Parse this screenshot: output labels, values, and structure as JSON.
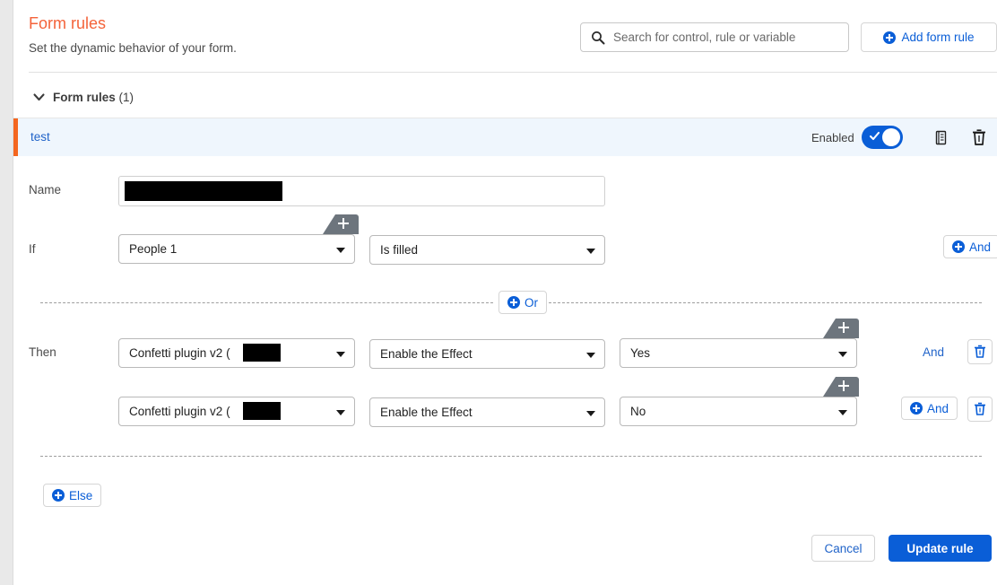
{
  "header": {
    "title": "Form rules",
    "subtitle": "Set the dynamic behavior of your form.",
    "search_placeholder": "Search for control, rule or variable",
    "search_value": "",
    "search_icon": "search-icon",
    "add_rule_label": "Add form rule"
  },
  "section": {
    "collapse_label": "Form rules",
    "count": "(1)",
    "chevron": "⌄"
  },
  "rule": {
    "name": "test",
    "enabled_label": "Enabled",
    "enabled": true,
    "copy_icon": "copy-icon",
    "delete_icon": "trash-icon",
    "accent_color": "#f4661f",
    "highlight_color": "#eff6fd"
  },
  "form": {
    "name_label": "Name",
    "name_value": "",
    "if_label": "If",
    "then_label": "Then",
    "if_row": {
      "control": "People 1",
      "operator": "Is filled",
      "and_label": "And",
      "plus_tab": "add-condition-tab"
    },
    "or_label": "Or",
    "then_rows": [
      {
        "control": "Confetti plugin v2 (",
        "action": "Enable the Effect",
        "value": "Yes",
        "and_label": "And",
        "delete_icon": "trash-icon",
        "plus_tab": "add-action-tab"
      },
      {
        "control": "Confetti plugin v2 (",
        "action": "Enable the Effect",
        "value": "No",
        "and_label": "And",
        "delete_icon": "trash-icon",
        "plus_tab": "add-action-tab"
      }
    ],
    "else_label": "Else"
  },
  "footer": {
    "cancel_label": "Cancel",
    "update_label": "Update rule"
  },
  "colors": {
    "brand_orange": "#f4633a",
    "link_blue": "#0a5ed7",
    "primary_blue": "#0a5ed7"
  }
}
